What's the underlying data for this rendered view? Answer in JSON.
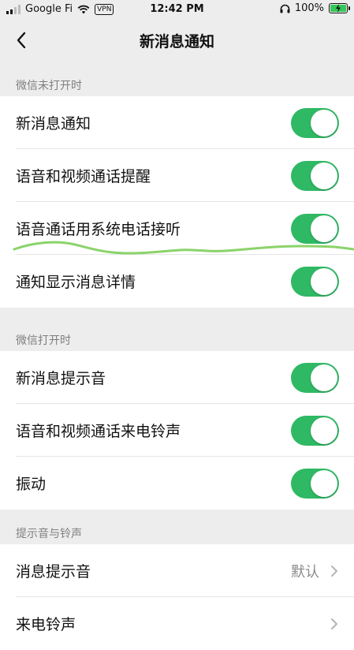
{
  "status_bar": {
    "carrier": "Google Fi",
    "vpn": "VPN",
    "time": "12:42 PM",
    "battery": "100%",
    "battery_level": 1.0,
    "icons": [
      "signal-icon",
      "wifi-icon",
      "headphones-icon",
      "battery-charging-icon"
    ]
  },
  "nav": {
    "title": "新消息通知",
    "back_icon": "chevron-left-icon"
  },
  "sections": [
    {
      "header": "微信未打开时",
      "rows": [
        {
          "label": "新消息通知",
          "toggle": true
        },
        {
          "label": "语音和视频通话提醒",
          "toggle": true
        },
        {
          "label": "语音通话用系统电话接听",
          "toggle": true
        },
        {
          "label": "通知显示消息详情",
          "toggle": true
        }
      ]
    },
    {
      "header": "微信打开时",
      "rows": [
        {
          "label": "新消息提示音",
          "toggle": true
        },
        {
          "label": "语音和视频通话来电铃声",
          "toggle": true
        },
        {
          "label": "振动",
          "toggle": true
        }
      ]
    },
    {
      "header": "提示音与铃声",
      "rows": [
        {
          "label": "消息提示音",
          "value": "默认"
        },
        {
          "label": "来电铃声",
          "value": ""
        }
      ]
    }
  ],
  "colors": {
    "toggle_on": "#2fb964",
    "background": "#ededed",
    "scribble": "#8bd36a"
  }
}
